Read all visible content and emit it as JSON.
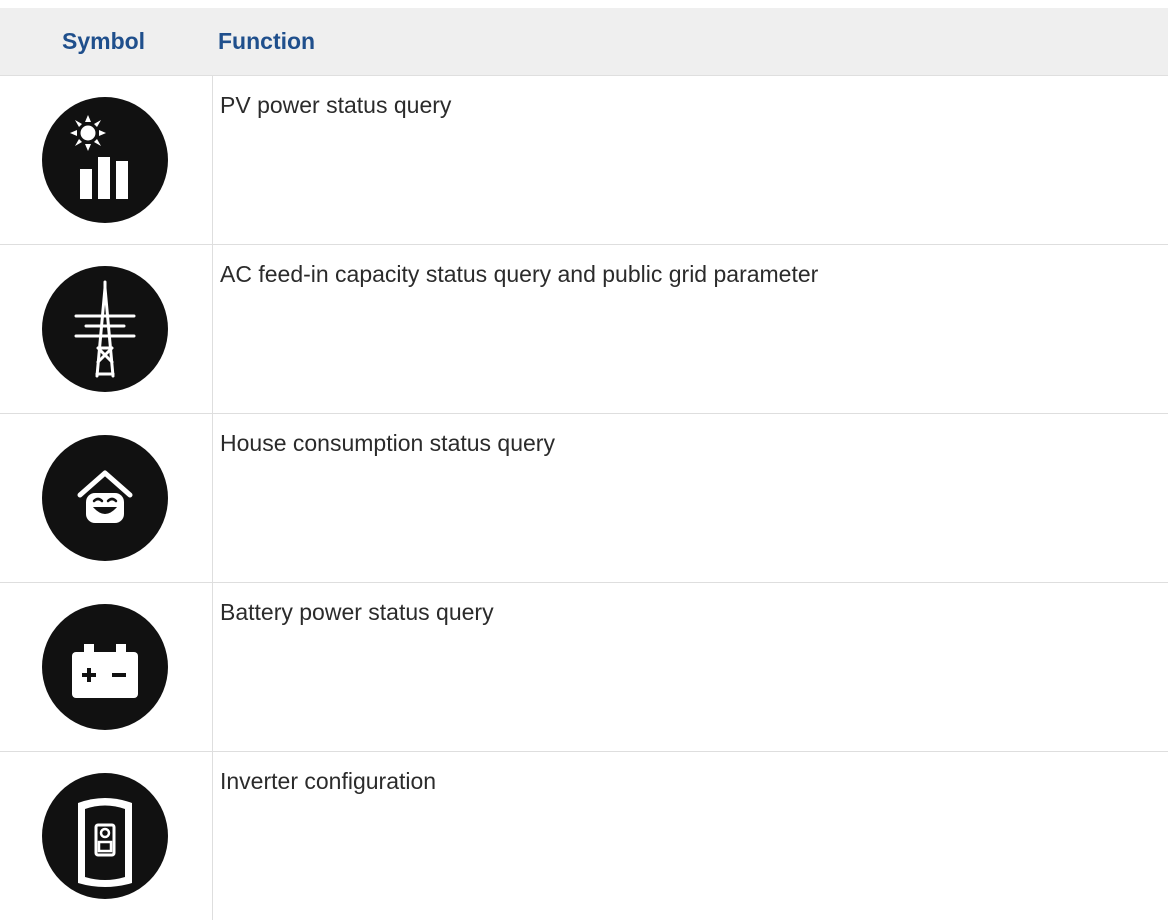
{
  "header": {
    "symbol_label": "Symbol",
    "function_label": "Function"
  },
  "colors": {
    "header_text": "#1f4f8c",
    "header_bg": "#efefef",
    "icon_bg": "#111111",
    "icon_fg": "#ffffff"
  },
  "rows": [
    {
      "icon": "pv-power-icon",
      "function": "PV power status query"
    },
    {
      "icon": "grid-pylon-icon",
      "function": "AC feed-in capacity status query and public grid parameter"
    },
    {
      "icon": "house-consumption-icon",
      "function": "House consumption status query"
    },
    {
      "icon": "battery-icon",
      "function": "Battery power status query"
    },
    {
      "icon": "inverter-icon",
      "function": "Inverter configuration"
    }
  ]
}
